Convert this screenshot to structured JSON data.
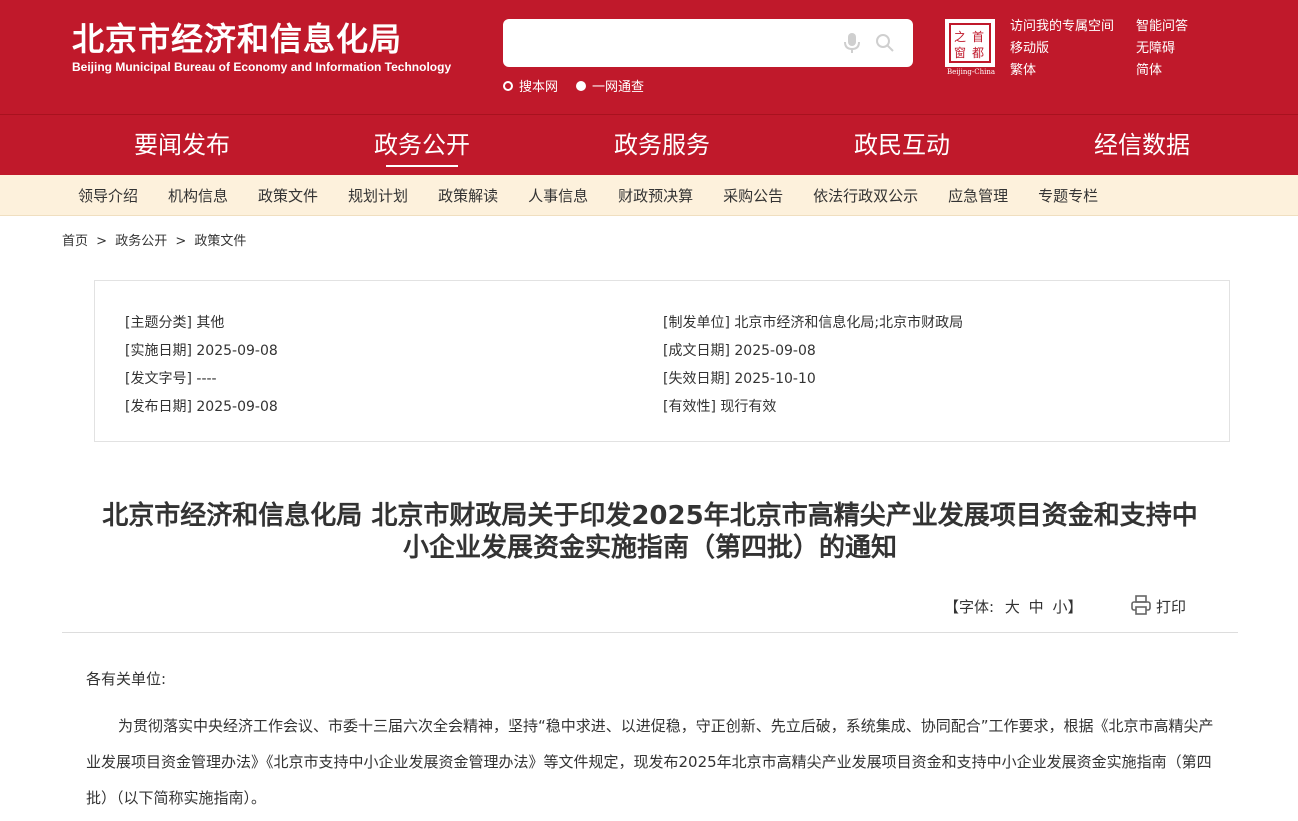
{
  "header": {
    "logo_cn": "北京市经济和信息化局",
    "logo_en": "Beijing Municipal Bureau of Economy and Information Technology",
    "search": {
      "placeholder": "",
      "scope_site": "搜本网",
      "scope_all": "一网通查"
    },
    "seal_chars": [
      "首",
      "都",
      "之",
      "窗"
    ],
    "seal_caption": "Beijing-China",
    "links_col1": [
      "访问我的专属空间",
      "移动版",
      "繁体"
    ],
    "links_col2": [
      "智能问答",
      "无障碍",
      "简体"
    ],
    "brand_color": "#c0192b"
  },
  "mainnav": {
    "items": [
      "要闻发布",
      "政务公开",
      "政务服务",
      "政民互动",
      "经信数据"
    ],
    "active": "政务公开"
  },
  "subnav": {
    "items": [
      "领导介绍",
      "机构信息",
      "政策文件",
      "规划计划",
      "政策解读",
      "人事信息",
      "财政预决算",
      "采购公告",
      "依法行政双公示",
      "应急管理",
      "专题专栏"
    ]
  },
  "breadcrumb": [
    "首页",
    ">",
    "政务公开",
    ">",
    "政策文件"
  ],
  "meta": {
    "topic_label": "[主题分类]",
    "topic": "其他",
    "issuer_label": "[制发单位]",
    "issuer": "北京市经济和信息化局;北京市财政局",
    "impl_label": "[实施日期]",
    "impl": "2025-09-08",
    "written_label": "[成文日期]",
    "written": "2025-09-08",
    "docno_label": "[发文字号]",
    "docno": "----",
    "expire_label": "[失效日期]",
    "expire": "2025-10-10",
    "pub_label": "[发布日期]",
    "pub": "2025-09-08",
    "validity_label": "[有效性]",
    "validity": "现行有效"
  },
  "article": {
    "title_line1": "北京市经济和信息化局 北京市财政局关于印发2025年北京市高精尖产业发展项目资金和支持中",
    "title_line2": "小企业发展资金实施指南（第四批）的通知",
    "font_label": "【字体:",
    "font_large": "大",
    "font_medium": "中",
    "font_small": "小】",
    "print_label": "打印",
    "salutation": "各有关单位:",
    "paragraph": "为贯彻落实中央经济工作会议、市委十三届六次全会精神，坚持“稳中求进、以进促稳，守正创新、先立后破，系统集成、协同配合”工作要求，根据《北京市高精尖产业发展项目资金管理办法》《北京市支持中小企业发展资金管理办法》等文件规定，现发布2025年北京市高精尖产业发展项目资金和支持中小企业发展资金实施指南（第四批）（以下简称实施指南）。"
  }
}
